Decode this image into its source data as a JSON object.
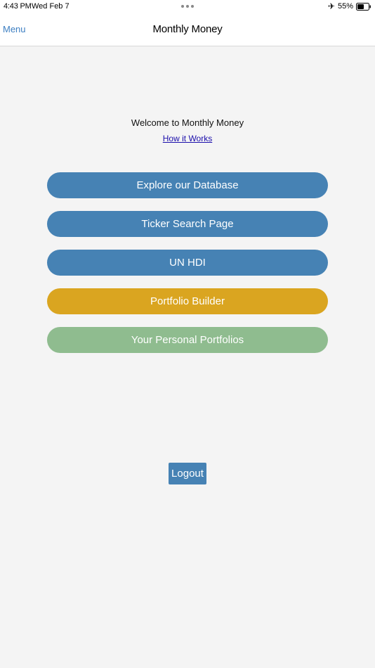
{
  "status_bar": {
    "time": "4:43 PM",
    "date": "Wed Feb 7",
    "battery": "55%",
    "airplane_icon": "airplane-icon",
    "battery_icon": "battery-icon"
  },
  "nav": {
    "menu_label": "Menu",
    "title": "Monthly Money"
  },
  "main": {
    "welcome": "Welcome to Monthly Money",
    "how_link": "How it Works",
    "buttons": [
      {
        "label": "Explore our Database",
        "color": "#4682b4"
      },
      {
        "label": "Ticker Search Page",
        "color": "#4682b4"
      },
      {
        "label": "UN HDI",
        "color": "#4682b4"
      },
      {
        "label": "Portfolio Builder",
        "color": "#daa520"
      },
      {
        "label": "Your Personal Portfolios",
        "color": "#8fbc8f"
      }
    ],
    "logout_label": "Logout"
  }
}
